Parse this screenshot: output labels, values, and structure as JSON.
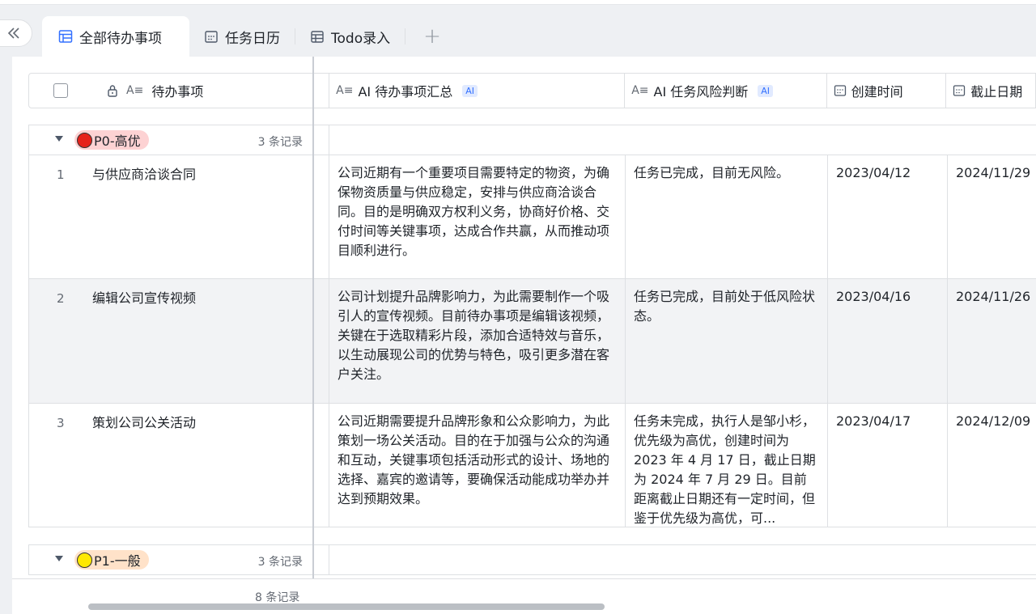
{
  "tabs": [
    {
      "label": "全部待办事项",
      "icon": "grid-table-icon",
      "active": true
    },
    {
      "label": "任务日历",
      "icon": "calendar-icon",
      "active": false
    },
    {
      "label": "Todo录入",
      "icon": "form-table-icon",
      "active": false
    }
  ],
  "collapse_icon": "double-chevron-left-icon",
  "add_tab_icon": "plus-icon",
  "columns": [
    {
      "label": "待办事项",
      "icon": "text-field-icon",
      "locked": true
    },
    {
      "label": "AI 待办事项汇总",
      "icon": "text-field-icon",
      "ai_badge": "AI"
    },
    {
      "label": "AI 任务风险判断",
      "icon": "text-field-icon",
      "ai_badge": "AI"
    },
    {
      "label": "创建时间",
      "icon": "date-field-icon"
    },
    {
      "label": "截止日期",
      "icon": "date-field-icon"
    }
  ],
  "groups": [
    {
      "label": "P0-高优",
      "dot_color": "#e5221b",
      "tag_bg": "#fdd2d3",
      "count": "3 条记录",
      "rows": [
        {
          "num": "1",
          "title": "与供应商洽谈合同",
          "summary": "公司近期有一个重要项目需要特定的物资，为确保物资质量与供应稳定，安排与供应商洽谈合同。目的是明确双方权利义务，协商好价格、交付时间等关键事项，达成合作共赢，从而推动项目顺利进行。",
          "risk": "任务已完成，目前无风险。",
          "created": "2023/04/12",
          "due": "2024/11/29"
        },
        {
          "num": "2",
          "title": "编辑公司宣传视频",
          "summary": "公司计划提升品牌影响力，为此需要制作一个吸引人的宣传视频。目前待办事项是编辑该视频，关键在于选取精彩片段，添加合适特效与音乐，以生动展现公司的优势与特色，吸引更多潜在客户关注。",
          "risk": "任务已完成，目前处于低风险状态。",
          "created": "2023/04/16",
          "due": "2024/11/26"
        },
        {
          "num": "3",
          "title": "策划公司公关活动",
          "summary": "公司近期需要提升品牌形象和公众影响力，为此策划一场公关活动。目的在于加强与公众的沟通和互动，关键事项包括活动形式的设计、场地的选择、嘉宾的邀请等，要确保活动能成功举办并达到预期效果。",
          "risk": "任务未完成，执行人是邹小杉，优先级为高优，创建时间为 2023 年 4 月 17 日，截止日期为 2024 年 7 月 29 日。目前距离截止日期还有一定时间，但鉴于优先级为高优，可...",
          "created": "2023/04/17",
          "due": "2024/12/09"
        }
      ]
    },
    {
      "label": "P1-一般",
      "dot_color": "#ffe800",
      "tag_bg": "#ffe2c9",
      "count": "3 条记录",
      "rows": []
    }
  ],
  "footer": {
    "total": "8 条记录"
  }
}
